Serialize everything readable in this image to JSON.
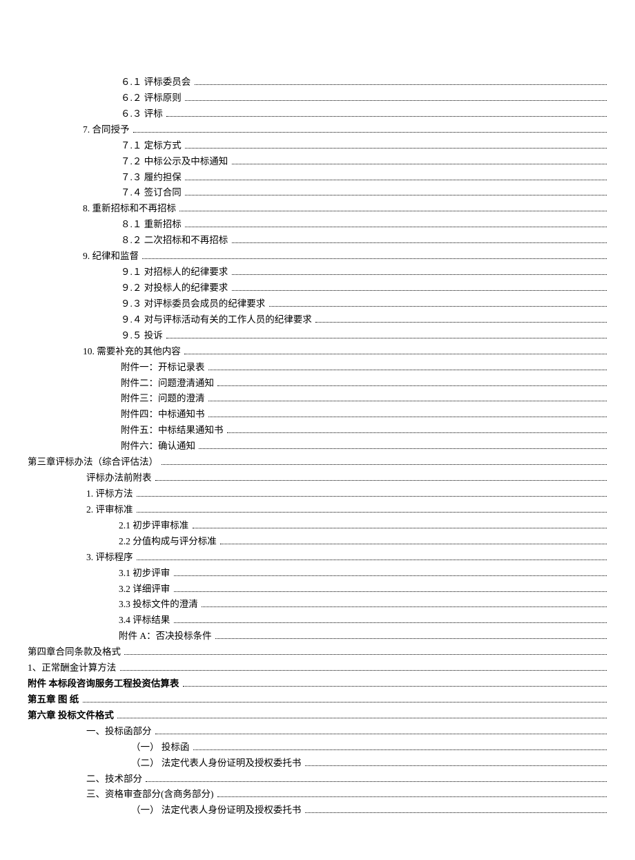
{
  "toc": [
    {
      "indent": "lvl-2",
      "label": "６.１  评标委员会",
      "bold": false
    },
    {
      "indent": "lvl-2",
      "label": "６.２  评标原则",
      "bold": false
    },
    {
      "indent": "lvl-2",
      "label": "６.３  评标",
      "bold": false
    },
    {
      "indent": "lvl-1",
      "label": "7.    合同授予",
      "bold": false
    },
    {
      "indent": "lvl-2",
      "label": "７.１  定标方式",
      "bold": false
    },
    {
      "indent": "lvl-2",
      "label": "７.２  中标公示及中标通知",
      "bold": false
    },
    {
      "indent": "lvl-2",
      "label": "７.３  履约担保",
      "bold": false
    },
    {
      "indent": "lvl-2",
      "label": "７.４  签订合同",
      "bold": false
    },
    {
      "indent": "lvl-1",
      "label": "8.    重新招标和不再招标",
      "bold": false
    },
    {
      "indent": "lvl-2",
      "label": "８.１  重新招标",
      "bold": false
    },
    {
      "indent": "lvl-2",
      "label": "８.２  二次招标和不再招标",
      "bold": false
    },
    {
      "indent": "lvl-1",
      "label": "9.    纪律和监督",
      "bold": false
    },
    {
      "indent": "lvl-2",
      "label": "９.１  对招标人的纪律要求",
      "bold": false
    },
    {
      "indent": "lvl-2",
      "label": "９.２  对投标人的纪律要求",
      "bold": false
    },
    {
      "indent": "lvl-2",
      "label": "９.３  对评标委员会成员的纪律要求",
      "bold": false
    },
    {
      "indent": "lvl-2",
      "label": "９.４  对与评标活动有关的工作人员的纪律要求",
      "bold": false
    },
    {
      "indent": "lvl-2",
      "label": "９.５  投诉",
      "bold": false
    },
    {
      "indent": "lvl-1",
      "label": "10.  需要补充的其他内容",
      "bold": false
    },
    {
      "indent": "lvl-2",
      "label": "附件一：开标记录表",
      "bold": false
    },
    {
      "indent": "lvl-2",
      "label": "附件二：问题澄清通知",
      "bold": false
    },
    {
      "indent": "lvl-2",
      "label": "附件三：问题的澄清",
      "bold": false
    },
    {
      "indent": "lvl-2",
      "label": "附件四：中标通知书",
      "bold": false
    },
    {
      "indent": "lvl-2",
      "label": "附件五：中标结果通知书",
      "bold": false
    },
    {
      "indent": "lvl-2",
      "label": "附件六：确认通知",
      "bold": false
    },
    {
      "indent": "ch-root",
      "label": "第三章评标办法（综合评估法）",
      "bold": false
    },
    {
      "indent": "ch-sub1",
      "label": "评标办法前附表",
      "bold": false
    },
    {
      "indent": "ch-sub1",
      "label": "1. 评标方法",
      "bold": false
    },
    {
      "indent": "ch-sub1",
      "label": "2. 评审标准",
      "bold": false
    },
    {
      "indent": "ch-sub2b",
      "label": "2.1 初步评审标准",
      "bold": false
    },
    {
      "indent": "ch-sub2b",
      "label": "2.2 分值构成与评分标准",
      "bold": false
    },
    {
      "indent": "ch-sub1",
      "label": "3. 评标程序",
      "bold": false
    },
    {
      "indent": "ch-sub2b",
      "label": "3.1 初步评审",
      "bold": false
    },
    {
      "indent": "ch-sub2b",
      "label": "3.2 详细评审",
      "bold": false
    },
    {
      "indent": "ch-sub2b",
      "label": "3.3 投标文件的澄清",
      "bold": false
    },
    {
      "indent": "ch-sub2b",
      "label": "3.4 评标结果",
      "bold": false
    },
    {
      "indent": "ch-sub2b",
      "label": "附件 A：否决投标条件",
      "bold": false
    },
    {
      "indent": "ch-root",
      "label": "第四章合同条款及格式",
      "bold": false
    },
    {
      "indent": "flush",
      "label": "1、正常酬金计算方法",
      "bold": false
    },
    {
      "indent": "flush",
      "label": "附件 本标段咨询服务工程投资估算表",
      "bold": true
    },
    {
      "indent": "flush",
      "label": "第五章  图  纸",
      "bold": true
    },
    {
      "indent": "flush",
      "label": "第六章   投标文件格式",
      "bold": true
    },
    {
      "indent": "ch-sub1",
      "label": "一、投标函部分",
      "bold": false
    },
    {
      "indent": "lvl-3",
      "label": "（一） 投标函",
      "bold": false
    },
    {
      "indent": "lvl-3",
      "label": "（二） 法定代表人身份证明及授权委托书",
      "bold": false
    },
    {
      "indent": "ch-sub1",
      "label": "二、技术部分",
      "bold": false
    },
    {
      "indent": "ch-sub1",
      "label": "三、资格审查部分(含商务部分)",
      "bold": false
    },
    {
      "indent": "lvl-3",
      "label": "（一） 法定代表人身份证明及授权委托书",
      "bold": false
    }
  ]
}
